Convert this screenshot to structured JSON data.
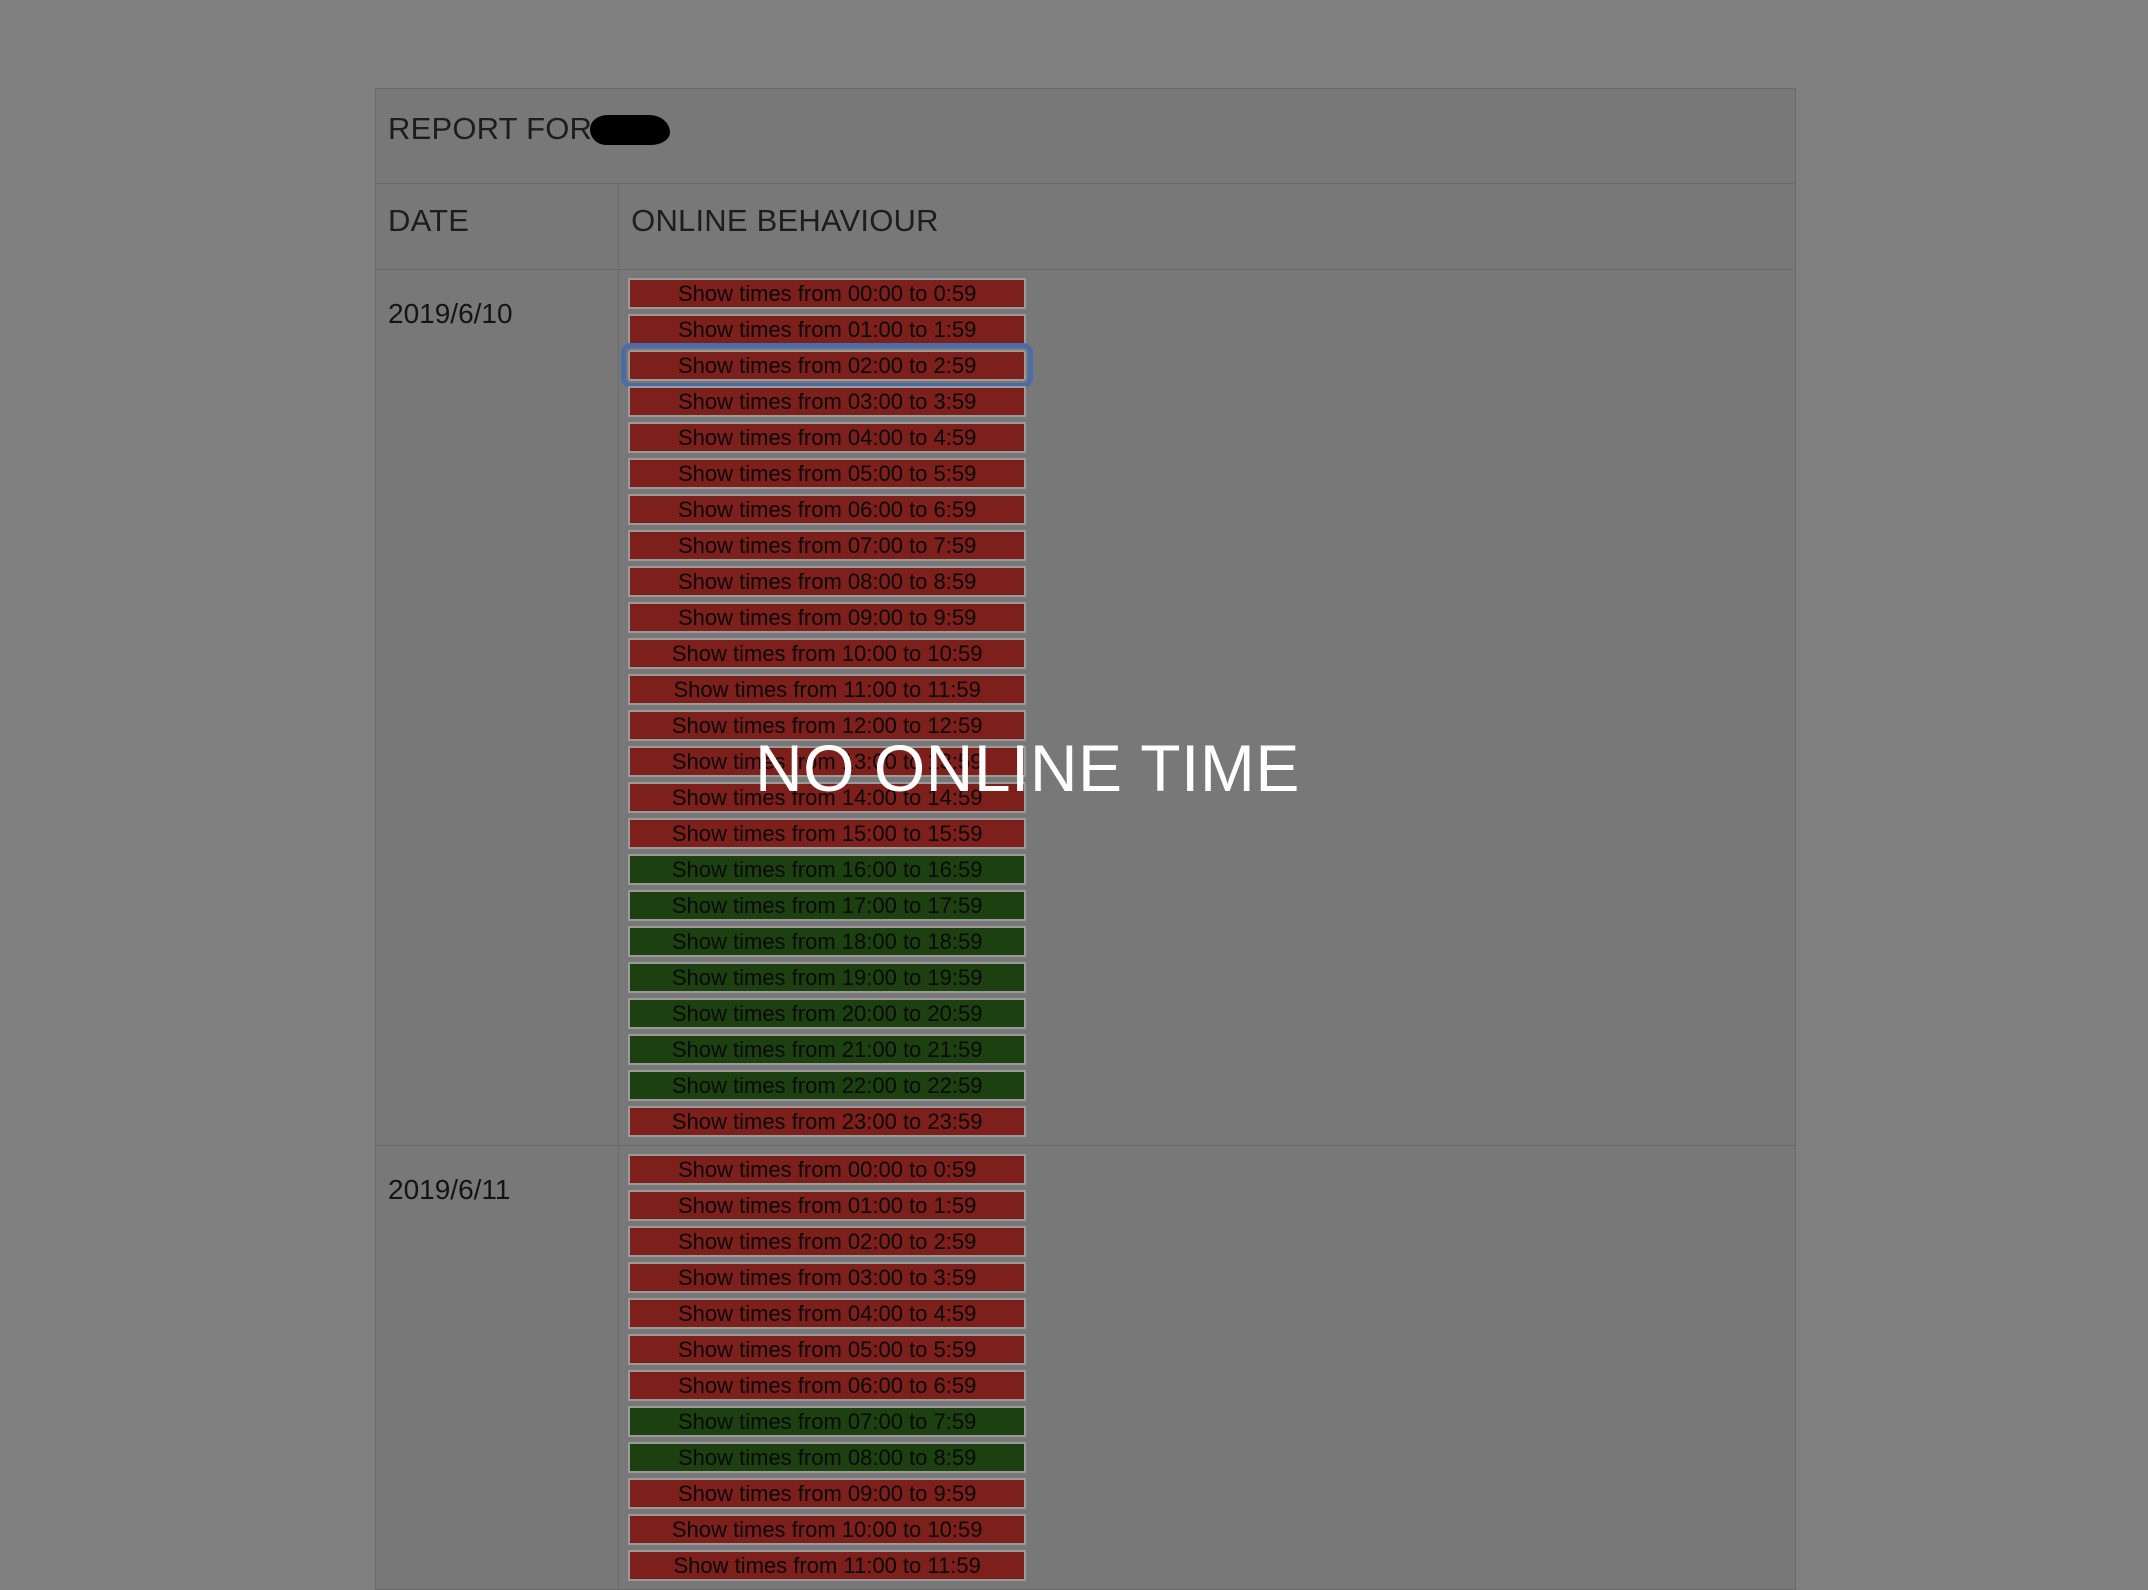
{
  "report": {
    "title_prefix": "REPORT FOR",
    "redacted_name": "",
    "columns": {
      "date": "DATE",
      "behaviour": "ONLINE BEHAVIOUR"
    }
  },
  "overlay": {
    "no_online_time": "NO ONLINE TIME"
  },
  "colors": {
    "page_background": "#808080",
    "cell_background": "#787878",
    "cell_border": "#6a6a6a",
    "offline_red": "#7d1f1a",
    "online_green": "#1d4010",
    "button_border": "#9a9a9a",
    "focus_ring": "#4c6ca6",
    "overlay_text": "#ffffff",
    "redaction": "#000000"
  },
  "rows": [
    {
      "date": "2019/6/10",
      "hours": [
        {
          "label": "Show times from 00:00 to 0:59",
          "state": "offline",
          "focused": false
        },
        {
          "label": "Show times from 01:00 to 1:59",
          "state": "offline",
          "focused": false
        },
        {
          "label": "Show times from 02:00 to 2:59",
          "state": "offline",
          "focused": true
        },
        {
          "label": "Show times from 03:00 to 3:59",
          "state": "offline",
          "focused": false
        },
        {
          "label": "Show times from 04:00 to 4:59",
          "state": "offline",
          "focused": false
        },
        {
          "label": "Show times from 05:00 to 5:59",
          "state": "offline",
          "focused": false
        },
        {
          "label": "Show times from 06:00 to 6:59",
          "state": "offline",
          "focused": false
        },
        {
          "label": "Show times from 07:00 to 7:59",
          "state": "offline",
          "focused": false
        },
        {
          "label": "Show times from 08:00 to 8:59",
          "state": "offline",
          "focused": false
        },
        {
          "label": "Show times from 09:00 to 9:59",
          "state": "offline",
          "focused": false
        },
        {
          "label": "Show times from 10:00 to 10:59",
          "state": "offline",
          "focused": false
        },
        {
          "label": "Show times from 11:00 to 11:59",
          "state": "offline",
          "focused": false
        },
        {
          "label": "Show times from 12:00 to 12:59",
          "state": "offline",
          "focused": false
        },
        {
          "label": "Show times from 13:00 to 13:59",
          "state": "offline",
          "focused": false
        },
        {
          "label": "Show times from 14:00 to 14:59",
          "state": "offline",
          "focused": false
        },
        {
          "label": "Show times from 15:00 to 15:59",
          "state": "offline",
          "focused": false
        },
        {
          "label": "Show times from 16:00 to 16:59",
          "state": "online",
          "focused": false
        },
        {
          "label": "Show times from 17:00 to 17:59",
          "state": "online",
          "focused": false
        },
        {
          "label": "Show times from 18:00 to 18:59",
          "state": "online",
          "focused": false
        },
        {
          "label": "Show times from 19:00 to 19:59",
          "state": "online",
          "focused": false
        },
        {
          "label": "Show times from 20:00 to 20:59",
          "state": "online",
          "focused": false
        },
        {
          "label": "Show times from 21:00 to 21:59",
          "state": "online",
          "focused": false
        },
        {
          "label": "Show times from 22:00 to 22:59",
          "state": "online",
          "focused": false
        },
        {
          "label": "Show times from 23:00 to 23:59",
          "state": "offline",
          "focused": false
        }
      ]
    },
    {
      "date": "2019/6/11",
      "hours": [
        {
          "label": "Show times from 00:00 to 0:59",
          "state": "offline",
          "focused": false
        },
        {
          "label": "Show times from 01:00 to 1:59",
          "state": "offline",
          "focused": false
        },
        {
          "label": "Show times from 02:00 to 2:59",
          "state": "offline",
          "focused": false
        },
        {
          "label": "Show times from 03:00 to 3:59",
          "state": "offline",
          "focused": false
        },
        {
          "label": "Show times from 04:00 to 4:59",
          "state": "offline",
          "focused": false
        },
        {
          "label": "Show times from 05:00 to 5:59",
          "state": "offline",
          "focused": false
        },
        {
          "label": "Show times from 06:00 to 6:59",
          "state": "offline",
          "focused": false
        },
        {
          "label": "Show times from 07:00 to 7:59",
          "state": "online",
          "focused": false
        },
        {
          "label": "Show times from 08:00 to 8:59",
          "state": "online",
          "focused": false
        },
        {
          "label": "Show times from 09:00 to 9:59",
          "state": "offline",
          "focused": false
        },
        {
          "label": "Show times from 10:00 to 10:59",
          "state": "offline",
          "focused": false
        },
        {
          "label": "Show times from 11:00 to 11:59",
          "state": "offline",
          "focused": false
        }
      ]
    }
  ]
}
